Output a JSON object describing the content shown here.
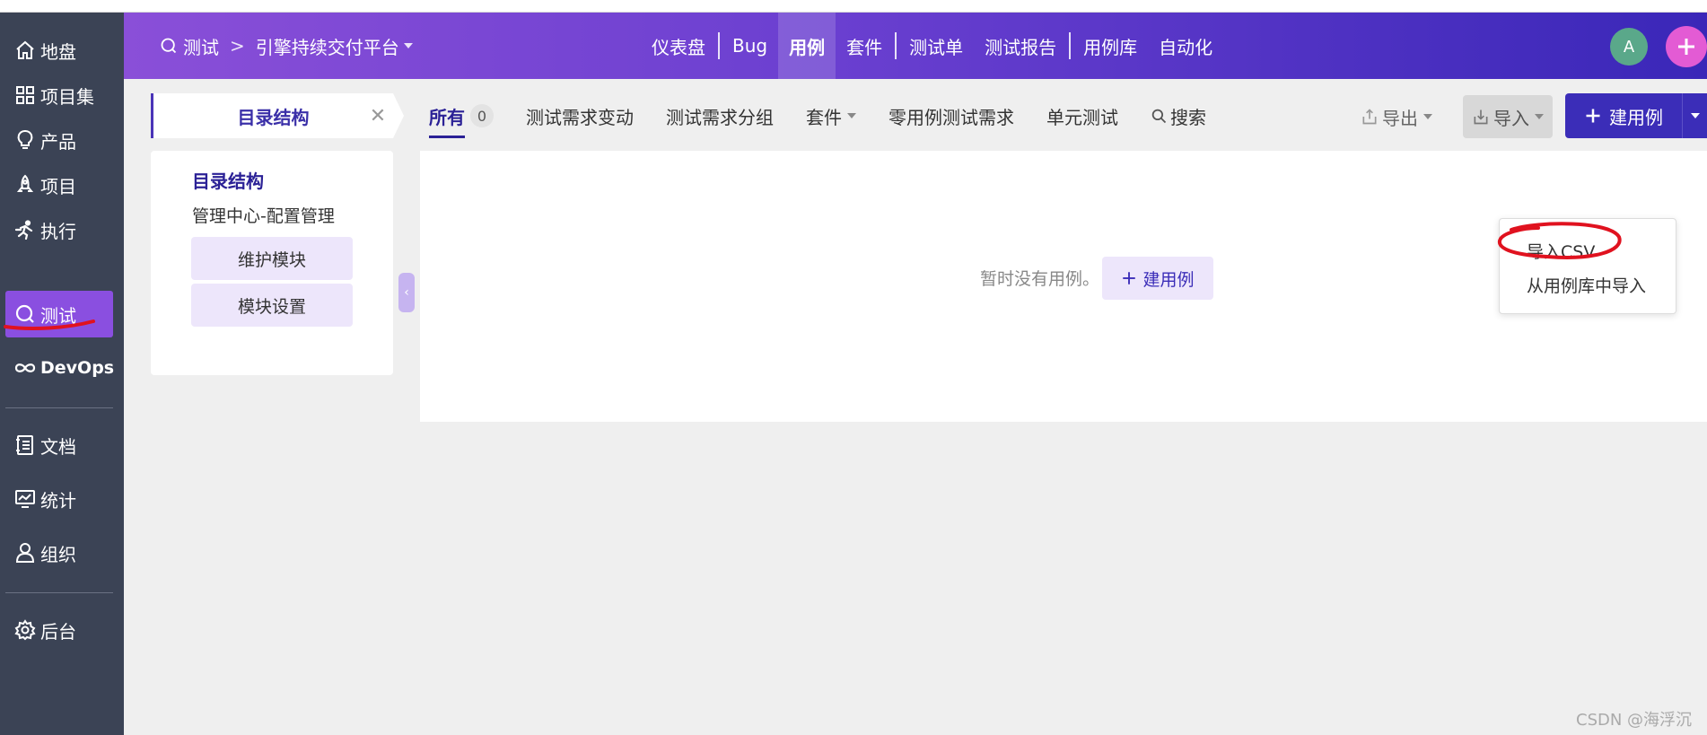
{
  "sidebar": {
    "items": [
      {
        "label": "地盘",
        "icon": "home-icon"
      },
      {
        "label": "项目集",
        "icon": "grid-icon"
      },
      {
        "label": "产品",
        "icon": "bulb-icon"
      },
      {
        "label": "项目",
        "icon": "rocket-icon"
      },
      {
        "label": "执行",
        "icon": "run-icon"
      },
      {
        "label": "测试",
        "icon": "test-icon"
      },
      {
        "label": "DevOps",
        "icon": "infinity-icon"
      },
      {
        "label": "文档",
        "icon": "doc-icon"
      },
      {
        "label": "统计",
        "icon": "monitor-icon"
      },
      {
        "label": "组织",
        "icon": "person-icon"
      },
      {
        "label": "后台",
        "icon": "gear-icon"
      }
    ],
    "active_index": 5
  },
  "header": {
    "module": "测试",
    "separator": ">",
    "product": "引擎持续交付平台",
    "nav": [
      "仪表盘",
      "Bug",
      "用例",
      "套件",
      "测试单",
      "测试报告",
      "用例库",
      "自动化"
    ],
    "active_nav": "用例",
    "avatar_letter": "A",
    "accent": "#3b2db8"
  },
  "toolbar": {
    "dir_tab": "目录结构",
    "tabs": [
      {
        "label": "所有",
        "count": "0"
      },
      {
        "label": "测试需求变动"
      },
      {
        "label": "测试需求分组"
      },
      {
        "label": "套件"
      },
      {
        "label": "零用例测试需求"
      },
      {
        "label": "单元测试"
      },
      {
        "label": "搜索"
      }
    ],
    "export_label": "导出",
    "import_label": "导入",
    "create_label": "建用例"
  },
  "dir_panel": {
    "title": "目录结构",
    "subtitle": "管理中心-配置管理",
    "btn_maintain": "维护模块",
    "btn_settings": "模块设置"
  },
  "main": {
    "empty_text": "暂时没有用例。",
    "create_label": "建用例"
  },
  "import_menu": {
    "items": [
      "导入CSV",
      "从用例库中导入"
    ]
  },
  "watermark": "CSDN @海浮沉"
}
